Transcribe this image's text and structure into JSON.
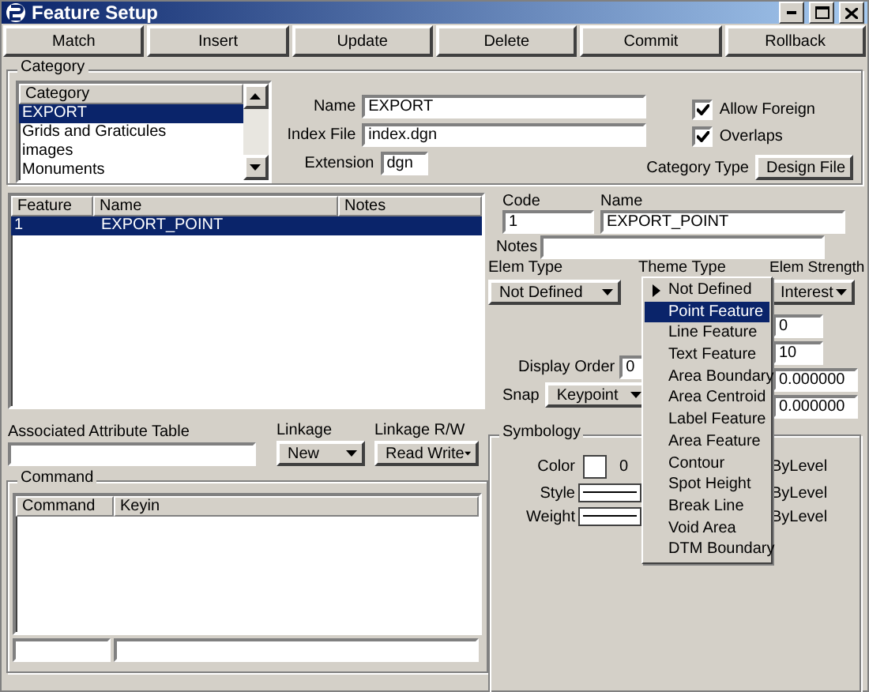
{
  "window": {
    "title": "Feature Setup"
  },
  "toolbar": [
    "Match",
    "Insert",
    "Update",
    "Delete",
    "Commit",
    "Rollback"
  ],
  "category": {
    "group_label": "Category",
    "list_header": "Category",
    "items": [
      {
        "label": "EXPORT",
        "selected": true
      },
      {
        "label": "Grids and Graticules",
        "selected": false
      },
      {
        "label": "images",
        "selected": false
      },
      {
        "label": "Monuments",
        "selected": false
      }
    ],
    "name_label": "Name",
    "name": "EXPORT",
    "index_file_label": "Index File",
    "index_file": "index.dgn",
    "extension_label": "Extension",
    "extension": "dgn",
    "options": [
      {
        "label": "Allow Foreign",
        "checked": true
      },
      {
        "label": "Overlaps",
        "checked": true
      }
    ],
    "category_type_label": "Category Type",
    "category_type": "Design File"
  },
  "features": {
    "columns": [
      "Feature",
      "Name",
      "Notes"
    ],
    "rows": [
      {
        "cells": [
          "1",
          "EXPORT_POINT"
        ],
        "selected": true
      }
    ]
  },
  "attribute_table": {
    "label": "Associated Attribute Table",
    "linkage_label": "Linkage",
    "linkage": "New",
    "linkage_rw_label": "Linkage R/W",
    "linkage_rw": "Read Write"
  },
  "command": {
    "group_label": "Command",
    "columns": [
      "Command",
      "Keyin"
    ]
  },
  "detail": {
    "code_label": "Code",
    "code": "1",
    "name_label": "Name",
    "name": "EXPORT_POINT",
    "notes_label": "Notes",
    "elem_type_label": "Elem Type",
    "elem_type": "Not Defined",
    "theme_type_label": "Theme Type",
    "elem_strength_label": "Elem Strength",
    "elem_strength": "Interest",
    "field_values": [
      "0",
      "10",
      "0.000000",
      "0.000000"
    ],
    "display_order_label": "Display Order",
    "display_order": "0",
    "snap_label": "Snap",
    "snap": "Keypoint"
  },
  "symbology": {
    "group_label": "Symbology",
    "color_label": "Color",
    "color_value": "0",
    "style_label": "Style",
    "weight_label": "Weight",
    "by_level": [
      "ByLevel",
      "ByLevel",
      "ByLevel"
    ]
  },
  "theme_menu": {
    "items": [
      {
        "label": "Not Defined",
        "current": true,
        "selected": false
      },
      {
        "label": "Point Feature",
        "current": false,
        "selected": true
      },
      {
        "label": "Line Feature",
        "current": false,
        "selected": false
      },
      {
        "label": "Text Feature",
        "current": false,
        "selected": false
      },
      {
        "label": "Area Boundary",
        "current": false,
        "selected": false
      },
      {
        "label": "Area Centroid",
        "current": false,
        "selected": false
      },
      {
        "label": "Label Feature",
        "current": false,
        "selected": false
      },
      {
        "label": "Area Feature",
        "current": false,
        "selected": false
      },
      {
        "label": "Contour",
        "current": false,
        "selected": false
      },
      {
        "label": "Spot Height",
        "current": false,
        "selected": false
      },
      {
        "label": "Break Line",
        "current": false,
        "selected": false
      },
      {
        "label": "Void Area",
        "current": false,
        "selected": false
      },
      {
        "label": "DTM Boundary",
        "current": false,
        "selected": false
      }
    ]
  }
}
